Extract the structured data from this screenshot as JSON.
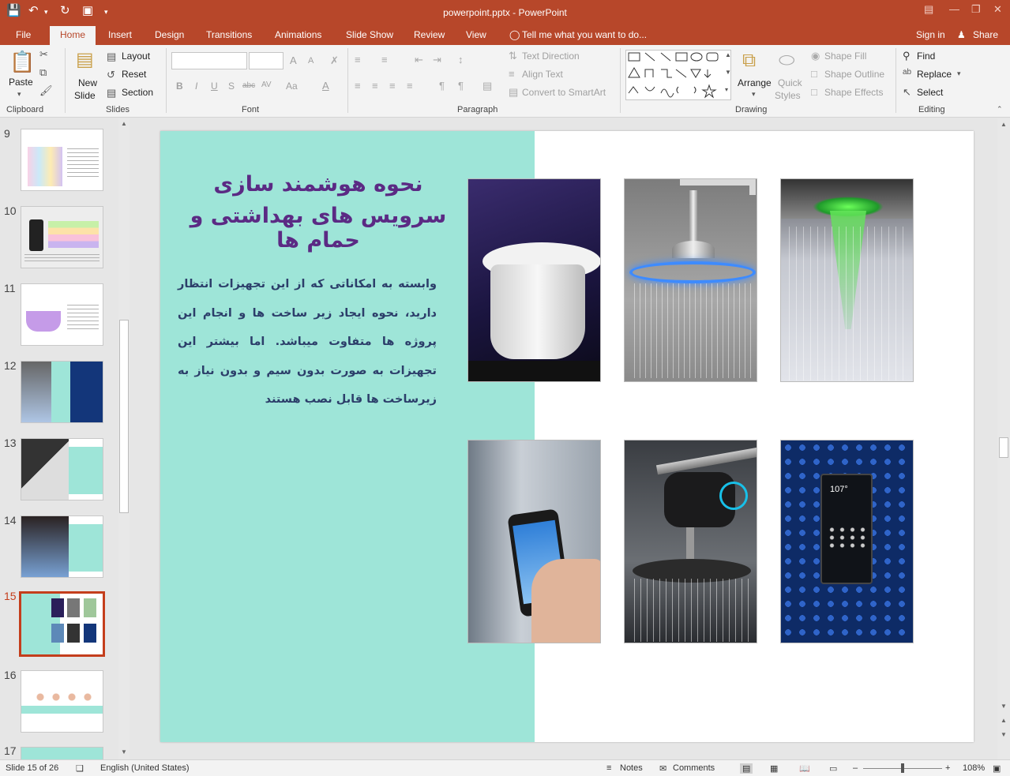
{
  "window": {
    "title": "powerpoint.pptx - PowerPoint",
    "qat": {
      "save_icon": "save-icon",
      "undo_icon": "undo-icon",
      "redo_icon": "redo-icon",
      "present_icon": "present-icon",
      "customize_icon": "chevron-down-icon"
    }
  },
  "tabs": [
    "File",
    "Home",
    "Insert",
    "Design",
    "Transitions",
    "Animations",
    "Slide Show",
    "Review",
    "View"
  ],
  "active_tab": "Home",
  "tell_me": "Tell me what you want to do...",
  "sign_in": "Sign in",
  "share": "Share",
  "ribbon": {
    "clipboard": {
      "label": "Clipboard",
      "paste": "Paste"
    },
    "slides": {
      "label": "Slides",
      "new_slide_1": "New",
      "new_slide_2": "Slide",
      "layout": "Layout",
      "reset": "Reset",
      "section": "Section"
    },
    "font": {
      "label": "Font",
      "bold": "B",
      "italic": "I",
      "underline": "U",
      "shadow": "S",
      "strike": "abc",
      "spacing": "AV",
      "case": "Aa",
      "color": "A",
      "grow": "A",
      "shrink": "A"
    },
    "paragraph": {
      "label": "Paragraph",
      "text_direction": "Text Direction",
      "align_text": "Align Text",
      "convert_smartart": "Convert to SmartArt"
    },
    "drawing": {
      "label": "Drawing",
      "arrange": "Arrange",
      "quick_styles_1": "Quick",
      "quick_styles_2": "Styles",
      "shape_fill": "Shape Fill",
      "shape_outline": "Shape Outline",
      "shape_effects": "Shape Effects"
    },
    "editing": {
      "label": "Editing",
      "find": "Find",
      "replace": "Replace",
      "select": "Select"
    }
  },
  "thumbnails": [
    {
      "num": "9",
      "selected": false
    },
    {
      "num": "10",
      "selected": false
    },
    {
      "num": "11",
      "selected": false
    },
    {
      "num": "12",
      "selected": false
    },
    {
      "num": "13",
      "selected": false
    },
    {
      "num": "14",
      "selected": false
    },
    {
      "num": "15",
      "selected": true
    },
    {
      "num": "16",
      "selected": false
    },
    {
      "num": "17",
      "selected": false
    }
  ],
  "slide": {
    "title_line1": "نحوه هوشمند سازی",
    "title_line2": "سرویس های بهداشتی و حمام ها",
    "body": "وابسته به امکاناتی که از این تجهیزات انتظار دارید، نحوه ایجاد زیر ساخت ها و انجام این پروژه ها متفاوت میباشد. اما بیشتر این تجهیزات به صورت بدون سیم و بدون نیاز به زیرساخت ها قابل نصب هستند",
    "photos": [
      "smart-toilet-photo",
      "led-rain-shower-photo",
      "ceiling-rain-shower-photo",
      "smartphone-control-photo",
      "smart-shower-head-photo",
      "digital-shower-panel-photo"
    ],
    "panel_temp": "107°"
  },
  "colors": {
    "accent": "#b7472a",
    "teal": "#9ee5d8",
    "title": "#5b2a84",
    "body": "#2c3e6a"
  },
  "status": {
    "slide_info": "Slide 15 of 26",
    "language": "English (United States)",
    "notes": "Notes",
    "comments": "Comments",
    "zoom": "108%"
  }
}
